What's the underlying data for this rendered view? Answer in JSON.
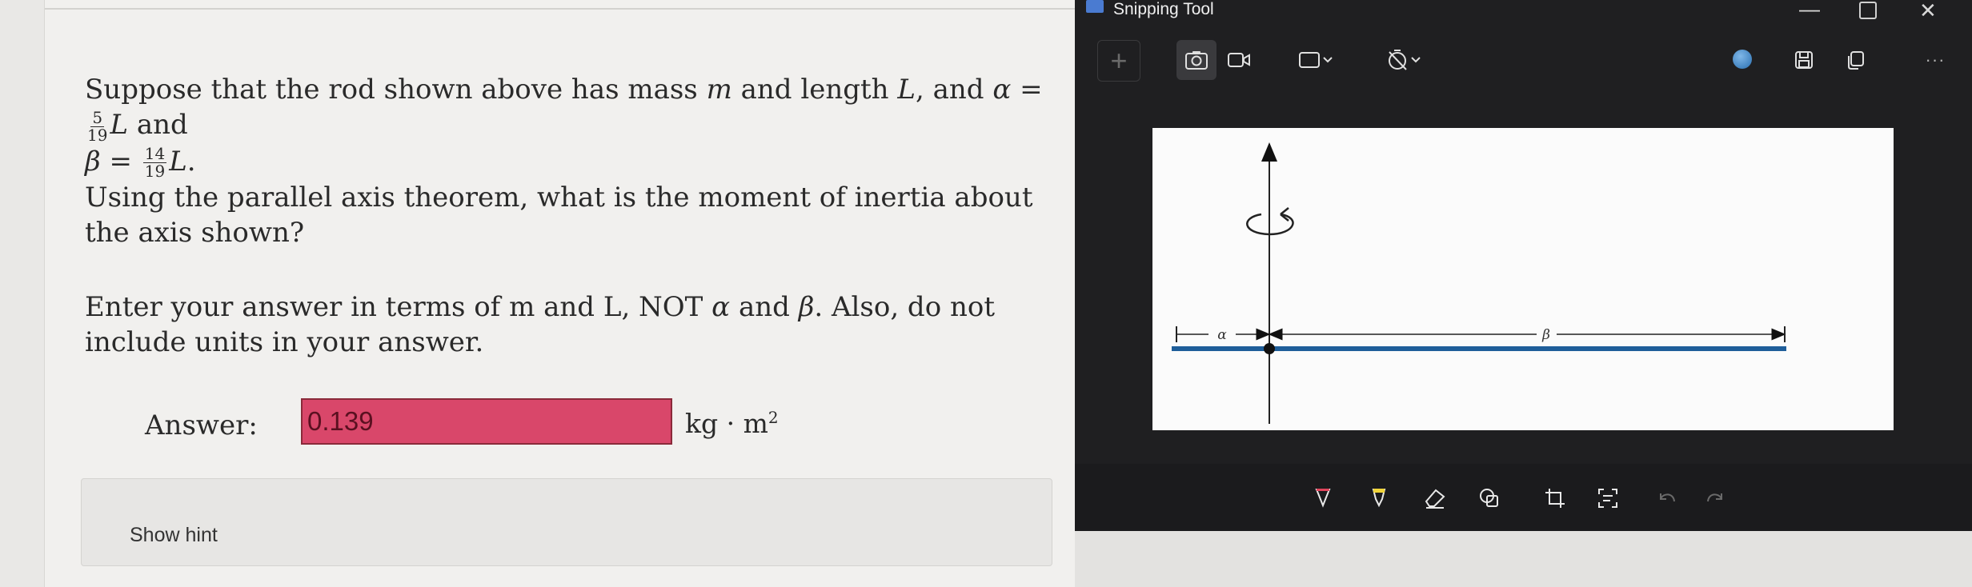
{
  "quiz": {
    "p1": {
      "t1": "Suppose that the rod shown above has mass ",
      "m": "m",
      "t2": " and length ",
      "L1": "L",
      "t3": ", and ",
      "alpha": "α",
      "eq": " = ",
      "alpha_num": "5",
      "alpha_den": "19",
      "L2": "L",
      "t4": " and",
      "beta": "β",
      "beta_num": "14",
      "beta_den": "19",
      "L3": "L",
      "t5": "."
    },
    "p2": "Using the parallel axis theorem, what is the moment of inertia about the axis shown?",
    "p3": {
      "t1": "Enter your answer in terms of m and L, NOT ",
      "alpha": "α",
      "t2": " and ",
      "beta": "β",
      "t3": ". Also, do not include units in your answer."
    },
    "answer_label": "Answer:",
    "answer_value": "0.139",
    "unit": "kg · m",
    "unit_exp": "2",
    "hint_label": "Show hint"
  },
  "snipping_tool": {
    "title": "Snipping Tool",
    "new_label": "+",
    "more_label": "···",
    "win_min": "—",
    "win_close": "✕",
    "diagram": {
      "alpha_label": "α",
      "beta_label": "β"
    }
  },
  "colors": {
    "answer_bg": "#d9476a",
    "rod": "#1e5e9a",
    "snip_bg": "#1f1f21"
  }
}
